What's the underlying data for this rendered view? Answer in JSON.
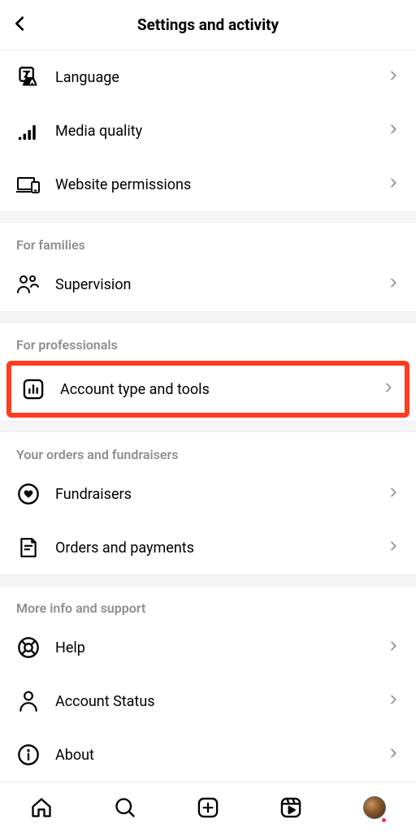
{
  "header": {
    "title": "Settings and activity"
  },
  "rows": {
    "language": "Language",
    "media_quality": "Media quality",
    "website_permissions": "Website permissions",
    "supervision": "Supervision",
    "account_type_tools": "Account type and tools",
    "fundraisers": "Fundraisers",
    "orders_payments": "Orders and payments",
    "help": "Help",
    "account_status": "Account Status",
    "about": "About"
  },
  "sections": {
    "for_families": "For families",
    "for_professionals": "For professionals",
    "orders_fundraisers": "Your orders and fundraisers",
    "more_info": "More info and support"
  }
}
